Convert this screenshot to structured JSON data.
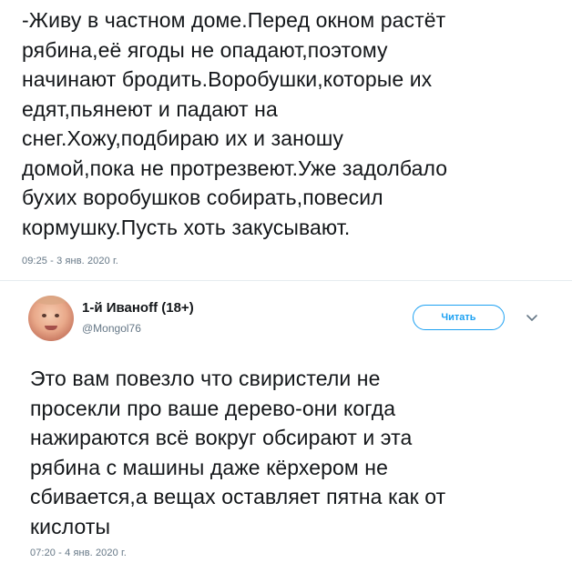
{
  "tweet_top": {
    "text": "-Живу в частном доме.Перед окном растёт\nрябина,её ягоды не опадают,поэтому\nначинают бродить.Воробушки,которые их\nедят,пьянеют и падают на\nснег.Хожу,подбираю их и заношу\nдомой,пока не протрезвеют.Уже задолбало\nбухих воробушков собирать,повесил\nкормушку.Пусть хоть закусывают.",
    "timestamp": "09:25 - 3 янв. 2020 г."
  },
  "reply": {
    "user_name": "1-й Иванoff (18+)",
    "user_handle": "@Mongol76",
    "follow_label": "Читать",
    "text": "Это вам повезло что свиристели не\nпросекли про ваше дерево-они когда\nнажираются всё вокруг обсирают и эта\nрябина с машины даже кёрхером не\nсбивается,а вещах оставляет пятна как от\nкислоты",
    "timestamp": "07:20 - 4 янв. 2020 г.",
    "avatar_icon": "baby-face-avatar",
    "menu_icon": "chevron-down-icon"
  },
  "colors": {
    "text": "#14171a",
    "muted": "#657786",
    "accent": "#1da1f2",
    "divider": "#e6ecf0"
  }
}
